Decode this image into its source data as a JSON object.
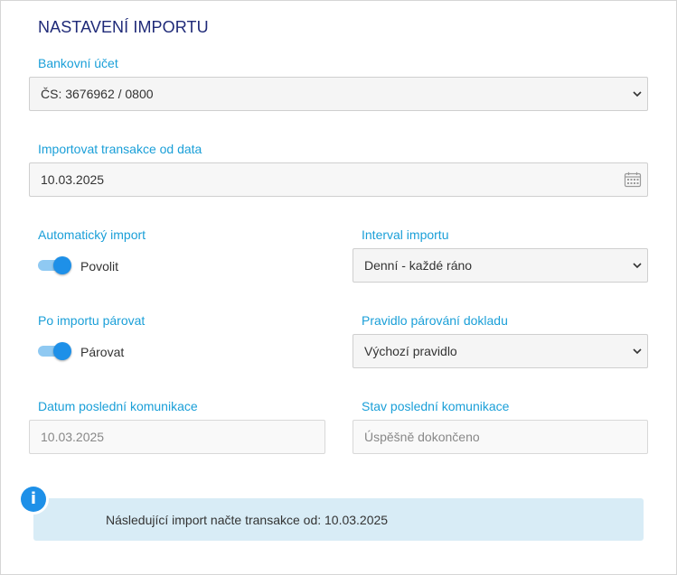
{
  "title": "NASTAVENÍ IMPORTU",
  "bank_account": {
    "label": "Bankovní účet",
    "value": "ČS: 3676962 / 0800",
    "icon": "chevron-down-icon"
  },
  "import_from_date": {
    "label": "Importovat transakce od data",
    "value": "10.03.2025",
    "icon": "calendar-icon"
  },
  "auto_import": {
    "label": "Automatický import",
    "toggle_label": "Povolit",
    "enabled": true
  },
  "import_interval": {
    "label": "Interval importu",
    "value": "Denní - každé ráno"
  },
  "match_after_import": {
    "label": "Po importu párovat",
    "toggle_label": "Párovat",
    "enabled": true
  },
  "matching_rule": {
    "label": "Pravidlo párování dokladu",
    "value": "Výchozí pravidlo"
  },
  "last_comm_date": {
    "label": "Datum poslední komunikace",
    "value": "10.03.2025"
  },
  "last_comm_status": {
    "label": "Stav poslední komunikace",
    "value": "Úspěšně dokončeno"
  },
  "info": {
    "icon_glyph": "i",
    "text": "Následující import načte transakce od: 10.03.2025"
  },
  "colors": {
    "title": "#1f2a78",
    "label": "#1a9fd8",
    "toggle_on": "#1e90e8",
    "info_bg": "#d8ecf6"
  }
}
